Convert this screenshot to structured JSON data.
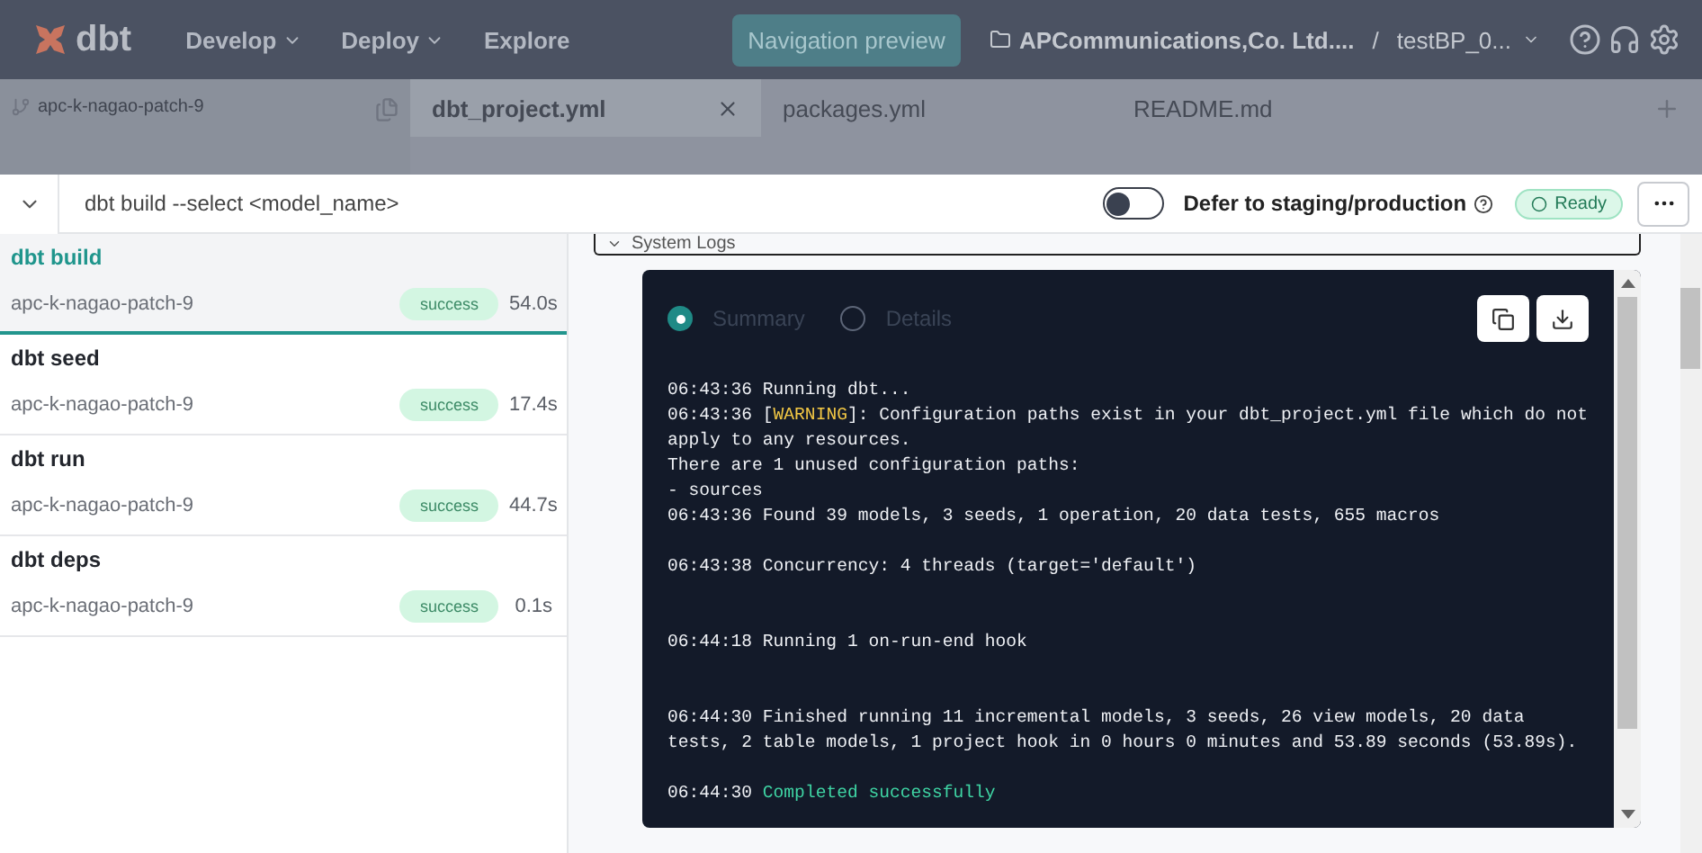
{
  "nav": {
    "logo": "dbt",
    "menu": [
      {
        "label": "Develop",
        "dropdown": true
      },
      {
        "label": "Deploy",
        "dropdown": true
      },
      {
        "label": "Explore",
        "dropdown": false
      }
    ],
    "preview_button": "Navigation preview",
    "account": "APCommunications,Co. Ltd....",
    "separator": "/",
    "project": "testBP_0..."
  },
  "editor": {
    "branch": "apc-k-nagao-patch-9",
    "tabs": [
      {
        "label": "dbt_project.yml",
        "selected": true
      },
      {
        "label": "packages.yml",
        "selected": false
      },
      {
        "label": "README.md",
        "selected": false
      }
    ]
  },
  "command_bar": {
    "command": "dbt build --select <model_name>",
    "defer_toggle": {
      "label": "Defer to staging/production",
      "on": false
    },
    "status": "Ready"
  },
  "runs": [
    {
      "command": "dbt build",
      "branch": "apc-k-nagao-patch-9",
      "status": "success",
      "duration": "54.0s",
      "selected": true
    },
    {
      "command": "dbt seed",
      "branch": "apc-k-nagao-patch-9",
      "status": "success",
      "duration": "17.4s",
      "selected": false
    },
    {
      "command": "dbt run",
      "branch": "apc-k-nagao-patch-9",
      "status": "success",
      "duration": "44.7s",
      "selected": false
    },
    {
      "command": "dbt deps",
      "branch": "apc-k-nagao-patch-9",
      "status": "success",
      "duration": "0.1s",
      "selected": false
    }
  ],
  "logs": {
    "section_title": "System Logs",
    "views": [
      {
        "label": "Summary",
        "selected": true
      },
      {
        "label": "Details",
        "selected": false
      }
    ],
    "lines": [
      {
        "kind": "line",
        "segments": [
          {
            "text": "06:43:36 Running dbt...",
            "kind": "plain"
          }
        ]
      },
      {
        "kind": "line",
        "segments": [
          {
            "text": "06:43:36 [",
            "kind": "plain"
          },
          {
            "text": "WARNING",
            "kind": "warning"
          },
          {
            "text": "]: Configuration paths exist in your dbt_project.yml file which do not apply to any resources.",
            "kind": "plain"
          }
        ]
      },
      {
        "kind": "line",
        "segments": [
          {
            "text": "There are 1 unused configuration paths:",
            "kind": "plain"
          }
        ]
      },
      {
        "kind": "line",
        "segments": [
          {
            "text": "- sources",
            "kind": "plain"
          }
        ]
      },
      {
        "kind": "line",
        "segments": [
          {
            "text": "06:43:36 Found 39 models, 3 seeds, 1 operation, 20 data tests, 655 macros",
            "kind": "plain"
          }
        ]
      },
      {
        "kind": "after-gap",
        "segments": [
          {
            "text": "06:43:38 Concurrency: 4 threads (target='default')",
            "kind": "plain"
          }
        ]
      },
      {
        "kind": "after-wide-gap",
        "segments": [
          {
            "text": "06:44:18 Running 1 on-run-end hook",
            "kind": "plain"
          }
        ]
      },
      {
        "kind": "after-wide-gap",
        "segments": [
          {
            "text": "06:44:30 Finished running 11 incremental models, 3 seeds, 26 view models, 20 data tests, 2 table models, 1 project hook in 0 hours 0 minutes and 53.89 seconds (53.89s).",
            "kind": "plain"
          }
        ]
      },
      {
        "kind": "after-gap",
        "segments": [
          {
            "text": "06:44:30 ",
            "kind": "plain"
          },
          {
            "text": "Completed successfully",
            "kind": "success"
          }
        ]
      }
    ]
  }
}
